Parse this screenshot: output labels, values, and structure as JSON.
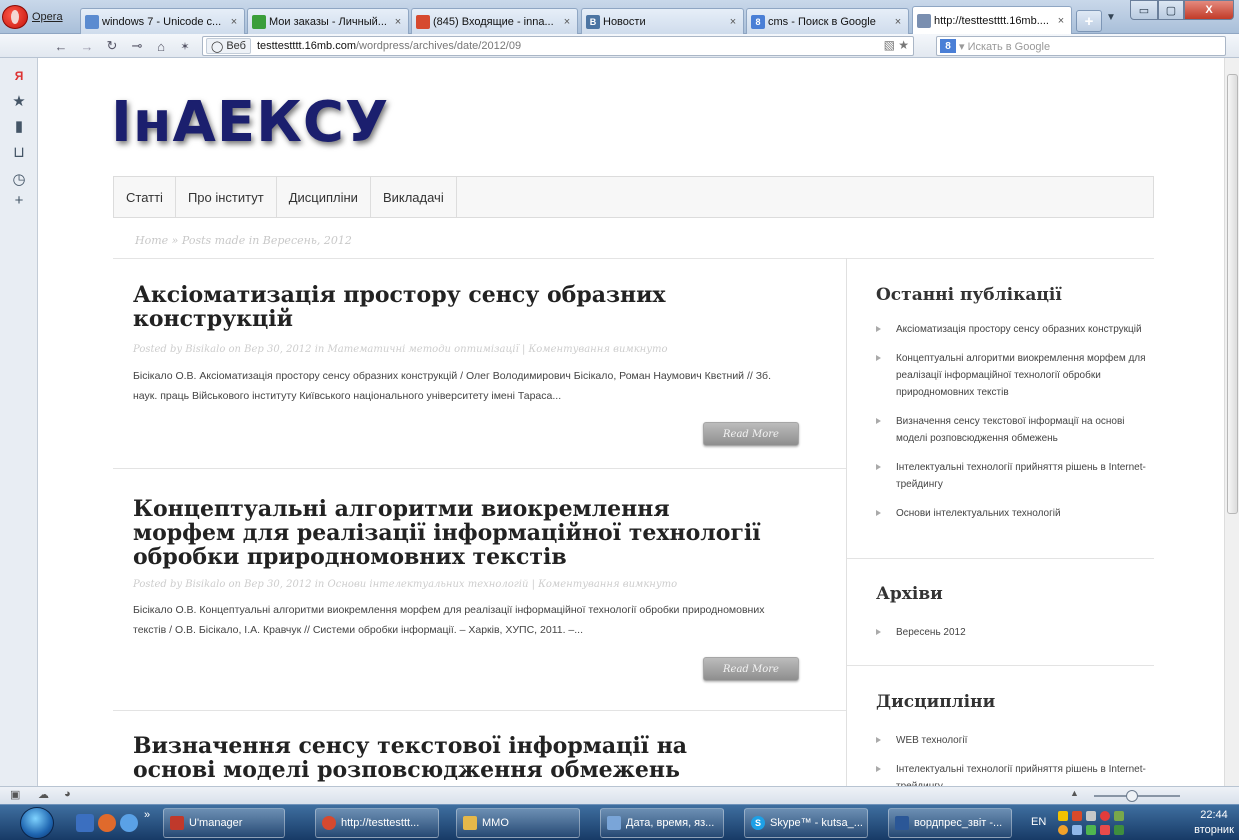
{
  "browser": {
    "menu_label": "Opera",
    "tabs": [
      {
        "title": "windows 7 - Unicode c...",
        "close": "×",
        "favicon": "#5b8bd0"
      },
      {
        "title": "Мои заказы - Личный...",
        "close": "×",
        "favicon": "#3a9e3a"
      },
      {
        "title": "(845) Входящие - inna...",
        "close": "×",
        "favicon": "#d6492f"
      },
      {
        "title": "Новости",
        "close": "×",
        "favicon": "#4c75a3",
        "favicon_text": "В"
      },
      {
        "title": "cms - Поиск в Google",
        "close": "×",
        "favicon": "#4a7fd6",
        "favicon_text": "8"
      },
      {
        "title": "http://testtestttt.16mb....",
        "close": "×",
        "favicon": "#7a8fb0"
      }
    ],
    "new_tab": "+",
    "tab_menu": "▼",
    "window_controls": {
      "minimize": "▭",
      "maximize": "▢",
      "close": "X"
    },
    "address": {
      "site_chip": "Веб",
      "url_host": "testtestttt.16mb.com",
      "url_path": "/wordpress/archives/date/2012/09",
      "icons": "▧ ★"
    },
    "search_engine": "8",
    "search_placeholder": "▾ Искать в Google"
  },
  "page": {
    "logo": "ІнАЕКСУ",
    "menu": [
      "Статті",
      "Про інститут",
      "Дисципліни",
      "Викладачі"
    ],
    "breadcrumb": "Home » Posts made in Вересень, 2012",
    "posts": [
      {
        "title": "Аксіоматизація простору сенсу образних конструкцій",
        "meta": "Posted by Bisikalo on Вер 30, 2012 in Математичні методи оптимізації | Коментування вимкнуто",
        "excerpt": "Бісікало О.В. Аксіоматизація простору сенсу образних конструкцій / Олег Володимирович Бісікало, Роман Наумович Квєтний // Зб. наук. праць Військового інституту Київського національного університету імені Тараса...",
        "read_more": "Read More"
      },
      {
        "title": "Концептуальні алгоритми виокремлення морфем для реалізації інформаційної технології обробки природномовних текстів",
        "meta": "Posted by Bisikalo on Вер 30, 2012 in Основи інтелектуальних технологій | Коментування вимкнуто",
        "excerpt": "Бісікало О.В. Концептуальні алгоритми виокремлення морфем для реалізації інформаційної технології обробки природномовних текстів / О.В. Бісікало, І.А. Кравчук // Системи обробки інформації. – Харків, ХУПС, 2011. –...",
        "read_more": "Read More"
      },
      {
        "title": "Визначення сенсу текстової інформації на основі моделі розповсюдження обмежень"
      }
    ],
    "sidebar": {
      "recent_title": "Останні публікації",
      "recent": [
        "Аксіоматизація простору сенсу образних конструкцій",
        "Концептуальні алгоритми виокремлення морфем для реалізації інформаційної технології обробки природномовних текстів",
        "Визначення сенсу текстової інформації на основі моделі розповсюдження обмежень",
        "Інтелектуальні технології прийняття рішень в Internet-трейдингу",
        "Основи інтелектуальних технологій"
      ],
      "archives_title": "Архіви",
      "archives": [
        "Вересень 2012"
      ],
      "disciplines_title": "Дисципліни",
      "disciplines": [
        "WEB технології",
        "Інтелектуальні технології прийняття рішень в Internet-трейдингу"
      ]
    }
  },
  "taskbar": {
    "items": [
      {
        "label": "U'manager",
        "icon": "#c0392b"
      },
      {
        "label": "http://testtesttt...",
        "icon": "#d6492f"
      },
      {
        "label": "MMO",
        "icon": "#e6b84a"
      },
      {
        "label": "Дата, время, яз...",
        "icon": "#7aa5d8"
      },
      {
        "label": "Skype™ - kutsa_...",
        "icon": "#1ea0e6",
        "icon_text": "S"
      },
      {
        "label": "вордпрес_звіт -...",
        "icon": "#2b5797"
      }
    ],
    "more": "»",
    "lang": "EN",
    "time": "22:44",
    "day": "вторник"
  },
  "colors": {
    "logo": "#1b1f6e",
    "taskbar": "#173a66",
    "tab_bar": "#a9bfd9"
  }
}
